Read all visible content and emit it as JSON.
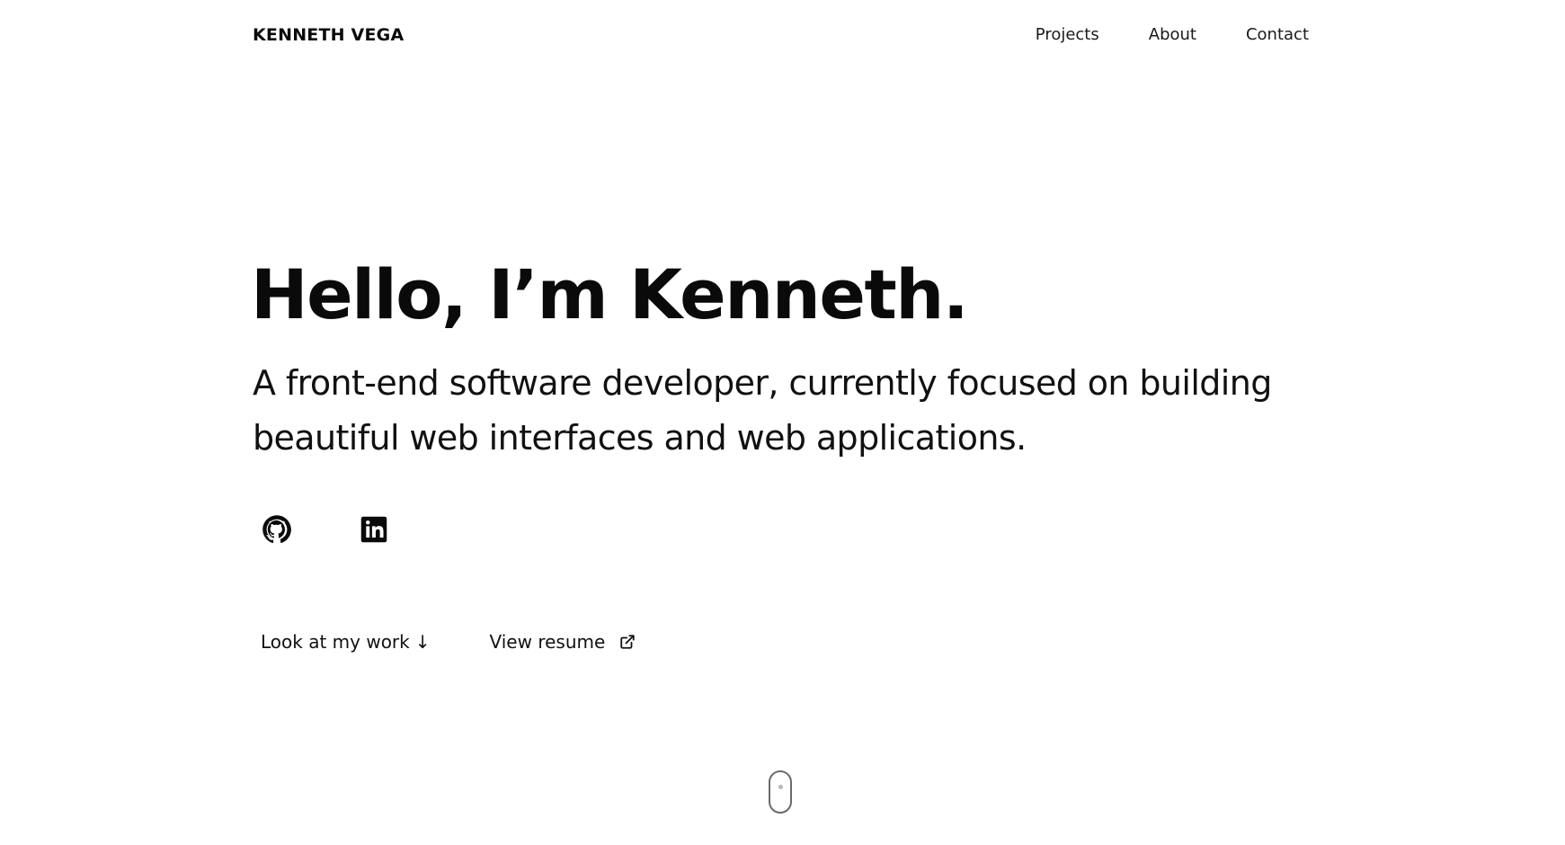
{
  "header": {
    "brand": "KENNETH VEGA",
    "nav": [
      {
        "label": "Projects"
      },
      {
        "label": "About"
      },
      {
        "label": "Contact"
      }
    ]
  },
  "hero": {
    "title": "Hello, I’m Kenneth.",
    "subtitle": "A front-end software developer, currently focused on building beautiful web interfaces and web applications."
  },
  "social": [
    {
      "icon": "github-icon"
    },
    {
      "icon": "linkedin-icon"
    }
  ],
  "cta": {
    "work_label": "Look at my work",
    "work_arrow": "↓",
    "resume_label": "View resume",
    "resume_icon": "external-link-icon"
  },
  "scroll_indicator": {
    "icon": "mouse-scroll-icon"
  },
  "colors": {
    "background": "#ffffff",
    "text": "#0a0a0a",
    "scroll_outline": "#6b6b6b"
  }
}
